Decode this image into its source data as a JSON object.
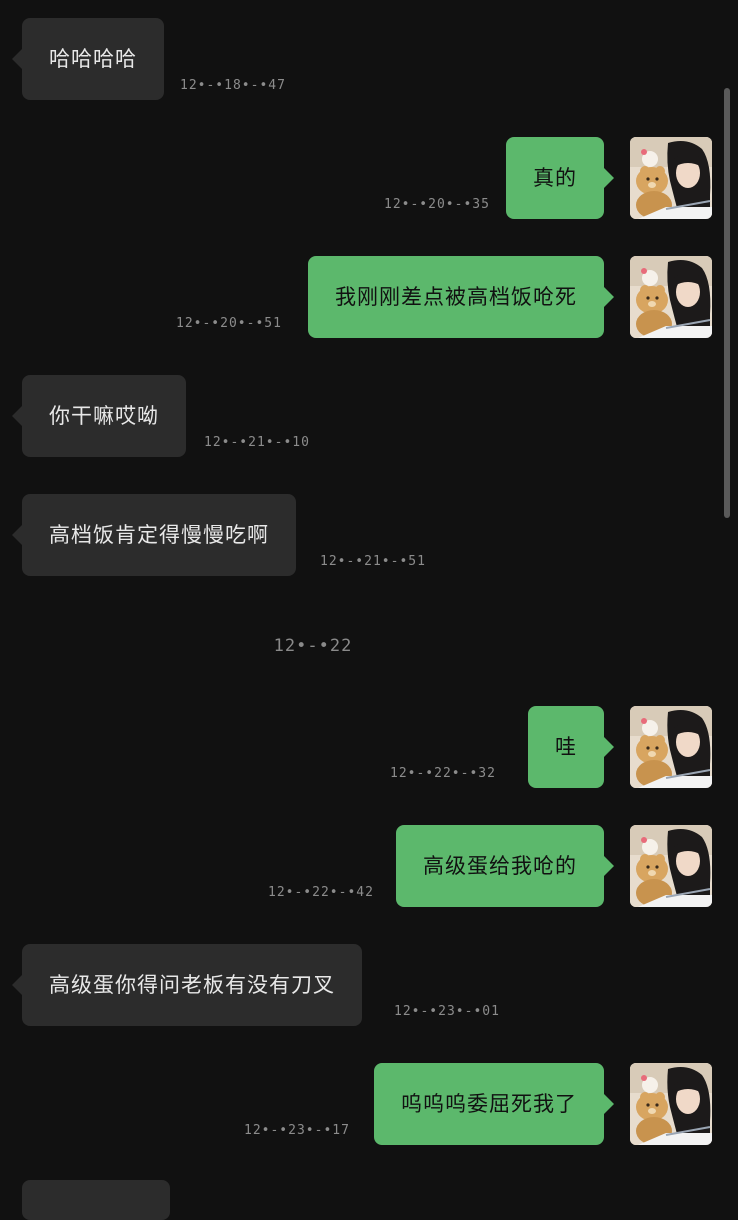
{
  "messages": [
    {
      "side": "in",
      "text": "哈哈哈哈",
      "time": "12•-•18•-•47"
    },
    {
      "side": "out",
      "text": "真的",
      "time": "12•-•20•-•35"
    },
    {
      "side": "out",
      "text": "我刚刚差点被高档饭呛死",
      "time": "12•-•20•-•51"
    },
    {
      "side": "in",
      "text": "你干嘛哎呦",
      "time": "12•-•21•-•10"
    },
    {
      "side": "in",
      "text": "高档饭肯定得慢慢吃啊",
      "time": "12•-•21•-•51"
    },
    {
      "side": "out",
      "text": "哇",
      "time": "12•-•22•-•32"
    },
    {
      "side": "out",
      "text": "高级蛋给我呛的",
      "time": "12•-•22•-•42"
    },
    {
      "side": "in",
      "text": "高级蛋你得问老板有没有刀叉",
      "time": "12•-•23•-•01"
    },
    {
      "side": "out",
      "text": "呜呜呜委屈死我了",
      "time": "12•-•23•-•17"
    }
  ],
  "divider": {
    "time": "12•-•22"
  },
  "colors": {
    "background": "#111111",
    "incoming_bubble": "#2c2c2c",
    "outgoing_bubble": "#5cb86c",
    "timestamp": "#8c8c8c"
  },
  "icons": {
    "avatar": "user-avatar-photo"
  }
}
